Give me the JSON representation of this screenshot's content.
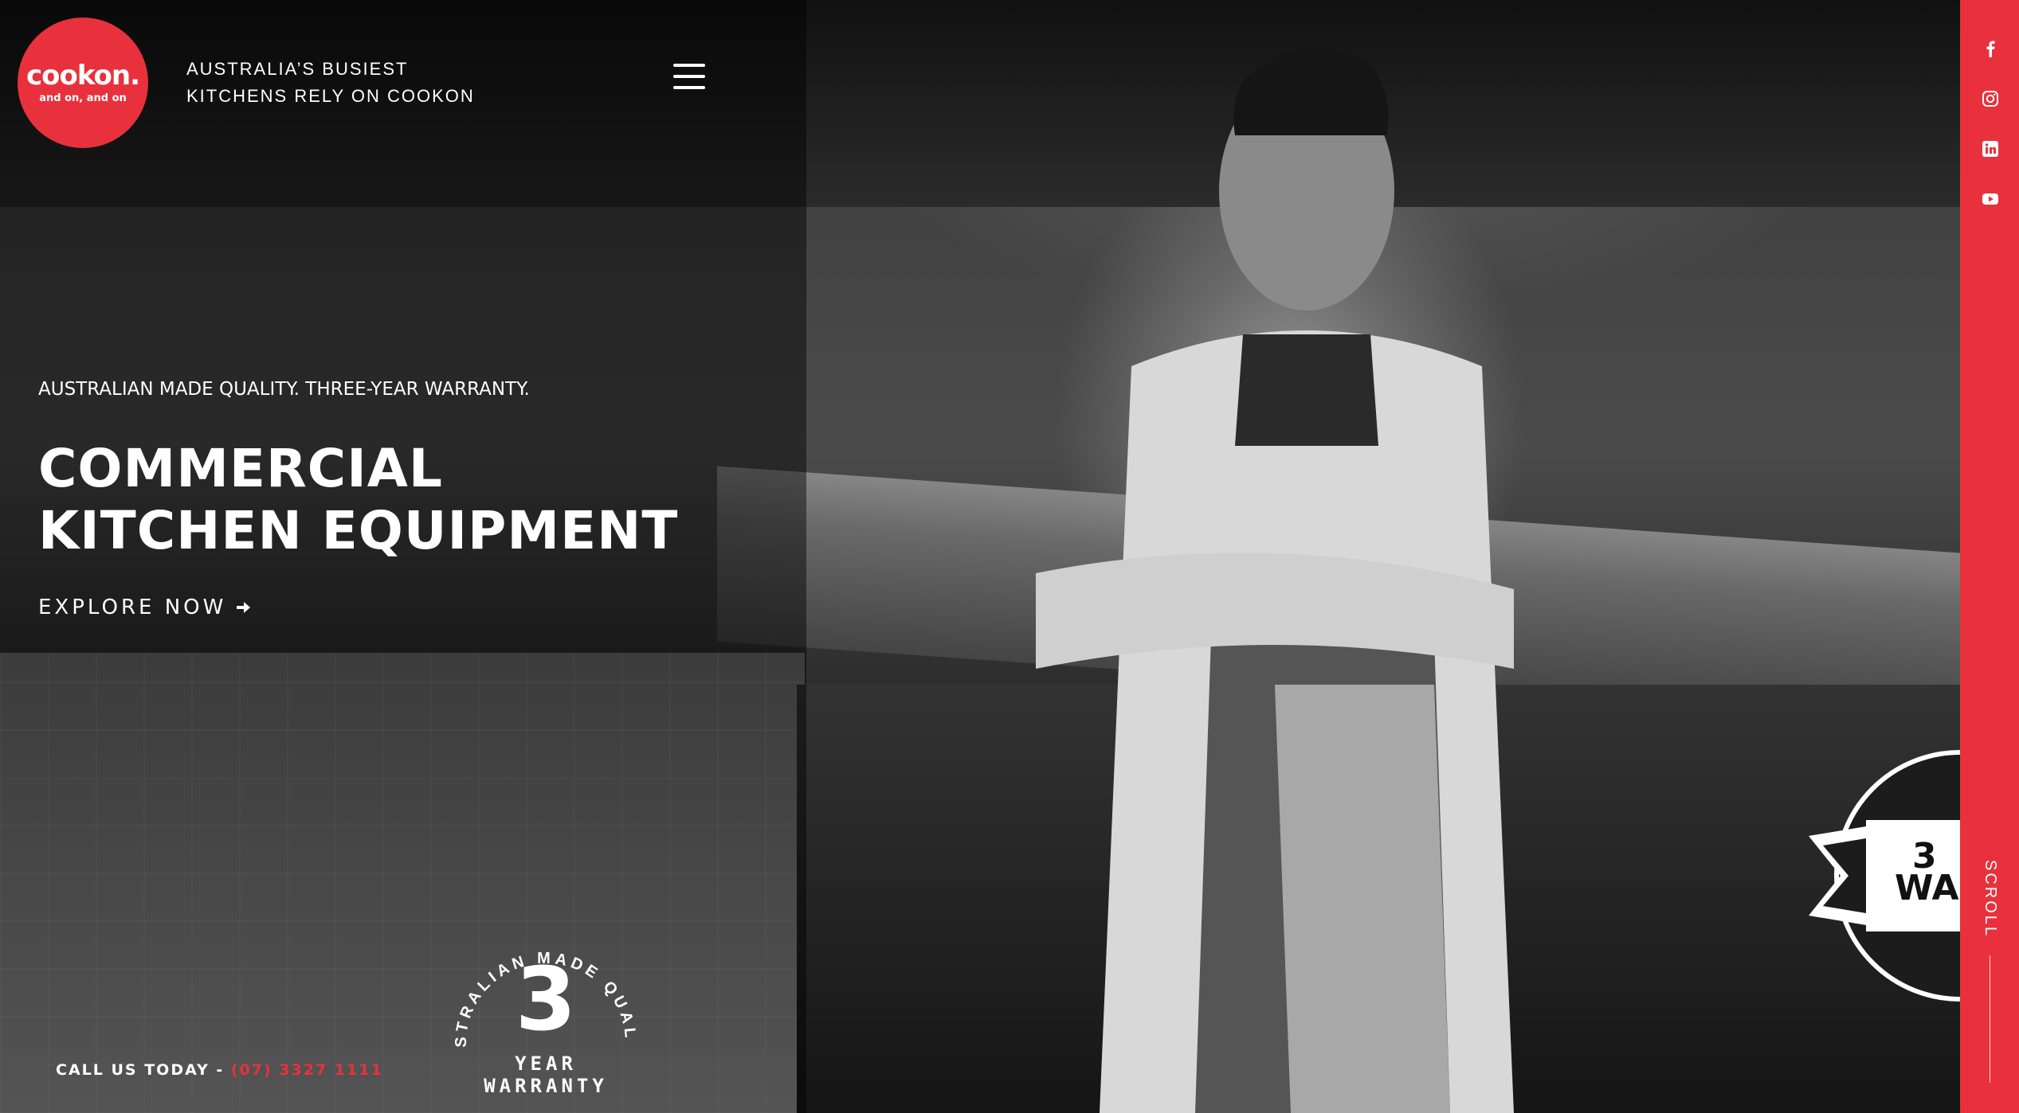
{
  "brand": {
    "logo_main": "cookon.",
    "logo_sub": "and on, and on",
    "tagline_line1": "AUSTRALIA’S BUSIEST",
    "tagline_line2": "KITCHENS RELY ON COOKON"
  },
  "hero": {
    "kicker": "AUSTRALIAN MADE QUALITY. THREE-YEAR WARRANTY.",
    "headline_line1": "COMMERCIAL",
    "headline_line2": "KITCHEN EQUIPMENT",
    "cta_label": "EXPLORE NOW"
  },
  "footer": {
    "call_label": "CALL US TODAY - ",
    "phone": "(07) 3327 1111"
  },
  "badge": {
    "arc_text": "AUSTRALIAN MADE QUALITY",
    "number": "3",
    "year_text": "YEAR WARRANTY"
  },
  "badge_right": {
    "number": "3",
    "text": "WA"
  },
  "sidebar": {
    "social": [
      "facebook-icon",
      "instagram-icon",
      "linkedin-icon",
      "youtube-icon"
    ],
    "scroll_label": "SCROLL"
  },
  "colors": {
    "accent": "#e8313c",
    "text": "#ffffff"
  }
}
